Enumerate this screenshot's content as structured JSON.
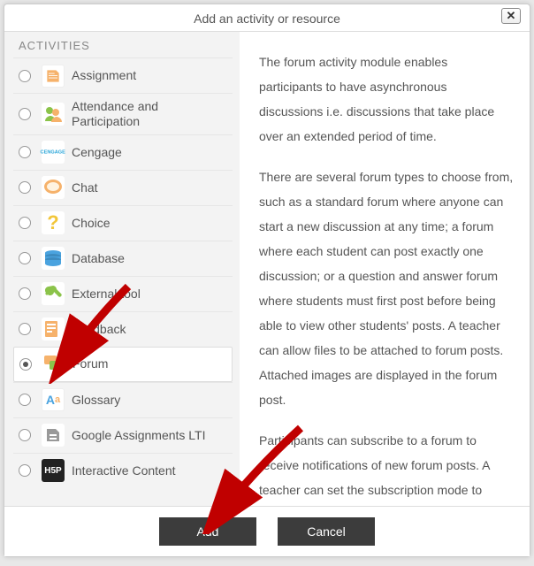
{
  "dialog": {
    "title": "Add an activity or resource",
    "close_label": "✕"
  },
  "section_head": "Activities",
  "activities": [
    {
      "id": "assignment",
      "label": "Assignment",
      "selected": false
    },
    {
      "id": "attendance",
      "label": "Attendance and Participation",
      "selected": false
    },
    {
      "id": "cengage",
      "label": "Cengage",
      "selected": false
    },
    {
      "id": "chat",
      "label": "Chat",
      "selected": false
    },
    {
      "id": "choice",
      "label": "Choice",
      "selected": false
    },
    {
      "id": "database",
      "label": "Database",
      "selected": false
    },
    {
      "id": "external",
      "label": "External tool",
      "selected": false
    },
    {
      "id": "feedback",
      "label": "Feedback",
      "selected": false
    },
    {
      "id": "forum",
      "label": "Forum",
      "selected": true
    },
    {
      "id": "glossary",
      "label": "Glossary",
      "selected": false
    },
    {
      "id": "google",
      "label": "Google Assignments LTI",
      "selected": false
    },
    {
      "id": "h5p",
      "label": "Interactive Content",
      "selected": false
    }
  ],
  "description": {
    "p1": "The forum activity module enables participants to have asynchronous discussions i.e. discussions that take place over an extended period of time.",
    "p2": "There are several forum types to choose from, such as a standard forum where anyone can start a new discussion at any time; a forum where each student can post exactly one discussion; or a question and answer forum where students must first post before being able to view other students' posts. A teacher can allow files to be attached to forum posts. Attached images are displayed in the forum post.",
    "p3": "Participants can subscribe to a forum to receive notifications of new forum posts. A teacher can set the subscription mode to optional, forced or auto, or prevent subscription completely. If required,"
  },
  "buttons": {
    "add": "Add",
    "cancel": "Cancel"
  },
  "icons": {
    "cengage_text": "CENGAGE",
    "h5p_text": "H5P",
    "glossary_text": "A",
    "glossary_sub": "a"
  }
}
